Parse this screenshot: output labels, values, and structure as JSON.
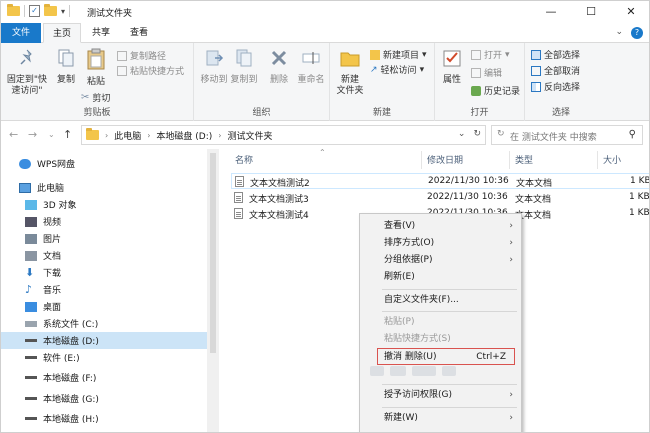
{
  "window": {
    "title": "测试文件夹",
    "controls": [
      "—",
      "☐",
      "✕"
    ]
  },
  "tabs": {
    "file": "文件",
    "home": "主页",
    "share": "共享",
    "view": "查看"
  },
  "ribbon": {
    "clipboard": {
      "label": "剪贴板",
      "pin": "固定到\"快\n速访问\"",
      "copy": "复制",
      "paste": "粘贴",
      "copy_path": "复制路径",
      "paste_shortcut": "粘贴快捷方式",
      "cut": "剪切"
    },
    "organize": {
      "label": "组织",
      "move_to": "移动到",
      "copy_to": "复制到",
      "delete": "删除",
      "rename": "重命名"
    },
    "new": {
      "label": "新建",
      "new_folder": "新建\n文件夹",
      "new_item": "新建项目",
      "easy_access": "轻松访问"
    },
    "open": {
      "label": "打开",
      "properties": "属性",
      "open": "打开",
      "edit": "编辑",
      "history": "历史记录"
    },
    "select": {
      "label": "选择",
      "select_all": "全部选择",
      "select_none": "全部取消",
      "invert": "反向选择"
    }
  },
  "address": {
    "crumbs": [
      "此电脑",
      "本地磁盘 (D:)",
      "测试文件夹"
    ],
    "search_placeholder": "在 测试文件夹 中搜索"
  },
  "nav": {
    "items": [
      {
        "label": "WPS网盘",
        "icon": "cloud-icon"
      },
      {
        "label": "此电脑",
        "icon": "computer-icon"
      },
      {
        "label": "3D 对象",
        "icon": "3d-objects-icon"
      },
      {
        "label": "视频",
        "icon": "video-icon"
      },
      {
        "label": "图片",
        "icon": "pictures-icon"
      },
      {
        "label": "文档",
        "icon": "documents-icon"
      },
      {
        "label": "下载",
        "icon": "download-icon"
      },
      {
        "label": "音乐",
        "icon": "music-icon"
      },
      {
        "label": "桌面",
        "icon": "desktop-icon"
      },
      {
        "label": "系统文件 (C:)",
        "icon": "drive-icon"
      },
      {
        "label": "本地磁盘 (D:)",
        "icon": "drive-icon"
      },
      {
        "label": "软件 (E:)",
        "icon": "drive-icon"
      },
      {
        "label": "本地磁盘 (F:)",
        "icon": "drive-icon"
      },
      {
        "label": "本地磁盘 (G:)",
        "icon": "drive-icon"
      },
      {
        "label": "本地磁盘 (H:)",
        "icon": "drive-icon"
      }
    ]
  },
  "columns": {
    "name": "名称",
    "date": "修改日期",
    "type": "类型",
    "size": "大小"
  },
  "files": [
    {
      "name": "文本文档测试2",
      "date": "2022/11/30 10:36",
      "type": "文本文档",
      "size": "1 KB"
    },
    {
      "name": "文本文档测试3",
      "date": "2022/11/30 10:36",
      "type": "文本文档",
      "size": "1 KB"
    },
    {
      "name": "文本文档测试4",
      "date": "2022/11/30 10:36",
      "type": "文本文档",
      "size": "1 KB"
    }
  ],
  "context_menu": {
    "view": "查看(V)",
    "sort": "排序方式(O)",
    "group": "分组依据(P)",
    "refresh": "刷新(E)",
    "customize": "自定义文件夹(F)...",
    "paste": "粘贴(P)",
    "paste_shortcut": "粘贴快捷方式(S)",
    "undo": "撤消 删除(U)",
    "undo_shortcut": "Ctrl+Z",
    "grant_access": "授予访问权限(G)",
    "new": "新建(W)"
  }
}
